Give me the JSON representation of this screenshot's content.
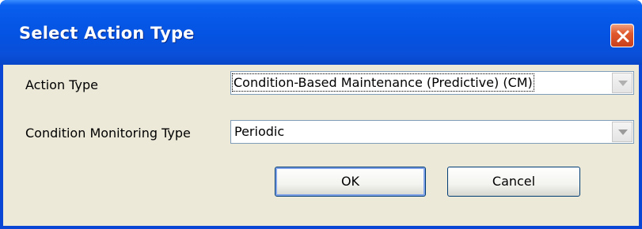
{
  "dialog": {
    "title": "Select Action Type",
    "close_icon": "close-icon"
  },
  "form": {
    "action_type_label": "Action Type",
    "action_type_value": "Condition-Based Maintenance (Predictive) (CM)",
    "action_type_disabled": true,
    "monitoring_type_label": "Condition Monitoring Type",
    "monitoring_type_value": "Periodic"
  },
  "buttons": {
    "ok_label": "OK",
    "cancel_label": "Cancel"
  },
  "colors": {
    "titlebar": "#0552e0",
    "client": "#ece9d8",
    "close": "#e15a2e"
  }
}
